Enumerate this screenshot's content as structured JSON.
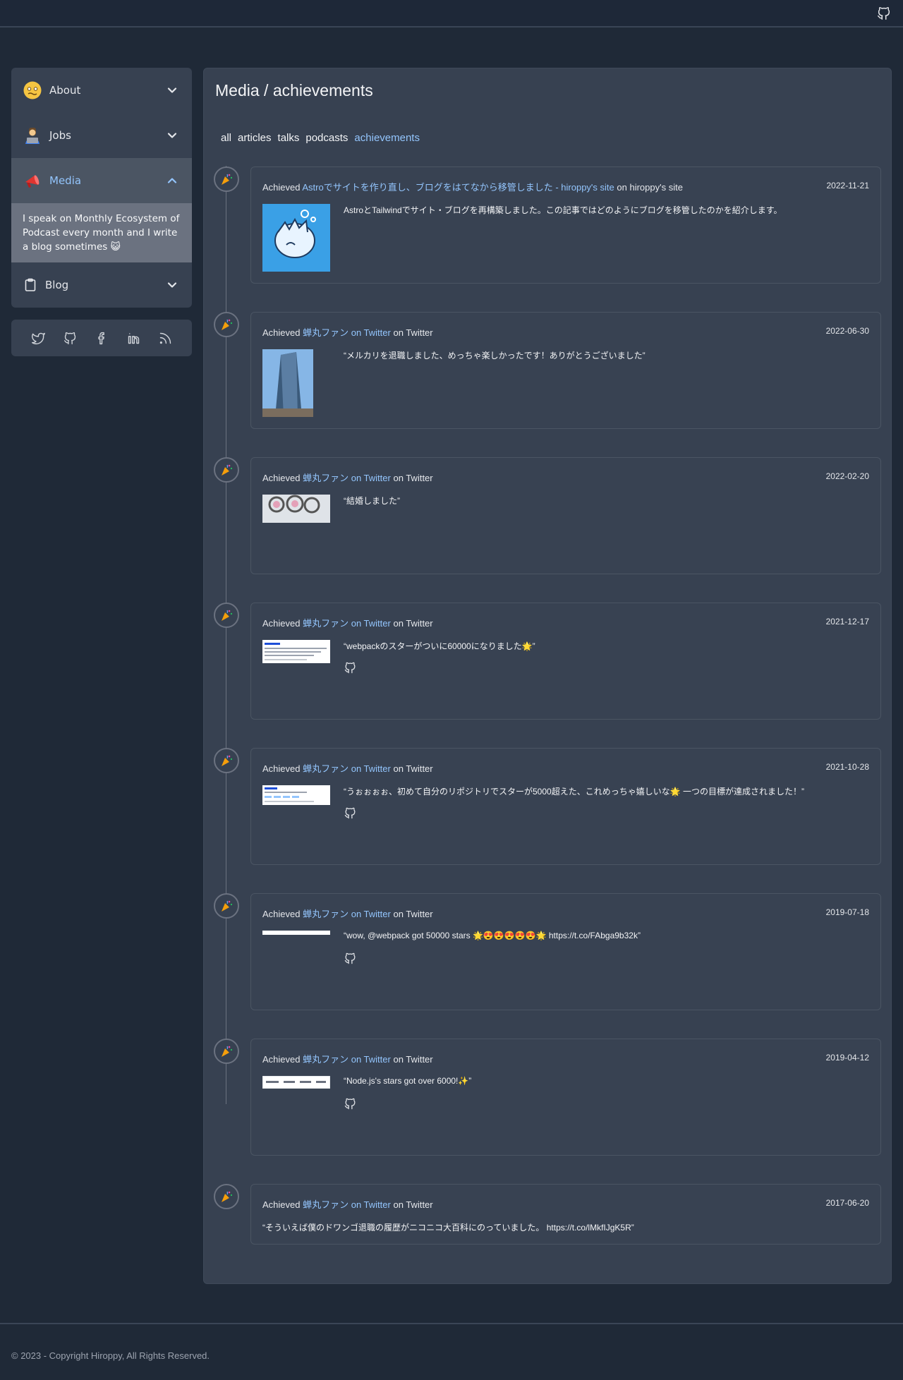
{
  "header": {
    "github_icon": "github-icon"
  },
  "sidebar": {
    "items": [
      {
        "label": "About",
        "icon": "woozy-face-emoji",
        "expanded": false
      },
      {
        "label": "Jobs",
        "icon": "technologist-emoji",
        "expanded": false
      },
      {
        "label": "Media",
        "icon": "megaphone-emoji",
        "expanded": true,
        "description": "I speak on Monthly Ecosystem of Podcast every month and I write a blog sometimes 😺"
      },
      {
        "label": "Blog",
        "icon": "clipboard-icon",
        "expanded": false
      }
    ],
    "social": [
      "twitter-icon",
      "github-icon",
      "facebook-icon",
      "linkedin-icon",
      "rss-icon"
    ]
  },
  "main": {
    "title": "Media / achievements",
    "tabs": [
      {
        "label": "all"
      },
      {
        "label": "articles"
      },
      {
        "label": "talks"
      },
      {
        "label": "podcasts"
      },
      {
        "label": "achievements",
        "active": true
      }
    ],
    "entries": [
      {
        "prefix": "Achieved",
        "link": "Astroでサイトを作り直し、ブログをはてなから移管しました - hiroppy's site",
        "on": "on",
        "site": "hiroppy's site",
        "date": "2022-11-21",
        "text": "AstroとTailwindでサイト・ブログを再構築しました。この記事ではどのようにブログを移管したのかを紹介します。"
      },
      {
        "prefix": "Achieved",
        "link": "蝉丸ファン on Twitter",
        "on": "on",
        "site": "Twitter",
        "date": "2022-06-30",
        "text": "“メルカリを退職しました、めっちゃ楽しかったです！ありがとうございました”"
      },
      {
        "prefix": "Achieved",
        "link": "蝉丸ファン on Twitter",
        "on": "on",
        "site": "Twitter",
        "date": "2022-02-20",
        "text": "“結婚しました”"
      },
      {
        "prefix": "Achieved",
        "link": "蝉丸ファン on Twitter",
        "on": "on",
        "site": "Twitter",
        "date": "2021-12-17",
        "text": "“webpackのスターがついに60000になりました🌟”"
      },
      {
        "prefix": "Achieved",
        "link": "蝉丸ファン on Twitter",
        "on": "on",
        "site": "Twitter",
        "date": "2021-10-28",
        "text": "“うぉぉぉぉ、初めて自分のリポジトリでスターが5000超えた、これめっちゃ嬉しいな🌟 一つの目標が達成されました！”"
      },
      {
        "prefix": "Achieved",
        "link": "蝉丸ファン on Twitter",
        "on": "on",
        "site": "Twitter",
        "date": "2019-07-18",
        "text": "“wow, @webpack got 50000 stars 🌟😍😍😍😍😍🌟 https://t.co/FAbga9b32k”"
      },
      {
        "prefix": "Achieved",
        "link": "蝉丸ファン on Twitter",
        "on": "on",
        "site": "Twitter",
        "date": "2019-04-12",
        "text": "“Node.js's stars got over 6000!✨”"
      },
      {
        "prefix": "Achieved",
        "link": "蝉丸ファン on Twitter",
        "on": "on",
        "site": "Twitter",
        "date": "2017-06-20",
        "text": "“そういえば僕のドワンゴ退職の履歴がニコニコ大百科にのっていました。 https://t.co/lMkfIJgK5R”"
      }
    ]
  },
  "footer": {
    "copyright": "© 2023 - Copyright Hiroppy, All Rights Reserved."
  },
  "colors": {
    "accent": "#93c5fd",
    "card": "#374151",
    "page": "#1f2937"
  }
}
